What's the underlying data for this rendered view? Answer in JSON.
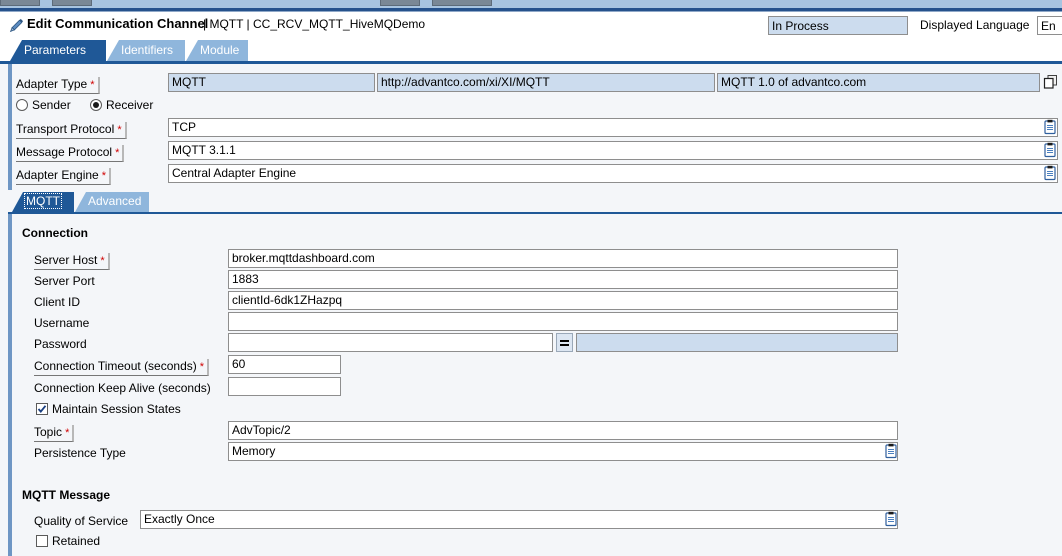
{
  "window": {
    "title": "Edit Communication Channel",
    "subtitle": "| MQTT | CC_RCV_MQTT_HiveMQDemo",
    "status": "In Process",
    "language_label": "Displayed Language",
    "language_value": "En"
  },
  "tabs_primary": [
    {
      "label": "Parameters",
      "active": true
    },
    {
      "label": "Identifiers",
      "active": false
    },
    {
      "label": "Module",
      "active": false
    }
  ],
  "adapter": {
    "type_label": "Adapter Type",
    "type_value": "MQTT",
    "namespace_value": "http://advantco.com/xi/XI/MQTT",
    "description_value": "MQTT 1.0 of advantco.com",
    "direction": {
      "sender_label": "Sender",
      "receiver_label": "Receiver",
      "selected": "Receiver"
    },
    "transport_protocol_label": "Transport Protocol",
    "transport_protocol_value": "TCP",
    "message_protocol_label": "Message Protocol",
    "message_protocol_value": "MQTT 3.1.1",
    "adapter_engine_label": "Adapter Engine",
    "adapter_engine_value": "Central Adapter Engine"
  },
  "tabs_secondary": [
    {
      "label": "MQTT",
      "active": true
    },
    {
      "label": "Advanced",
      "active": false
    }
  ],
  "connection": {
    "section_title": "Connection",
    "server_host_label": "Server Host",
    "server_host_value": "broker.mqttdashboard.com",
    "server_port_label": "Server Port",
    "server_port_value": "1883",
    "client_id_label": "Client ID",
    "client_id_value": "clientId-6dk1ZHazpq",
    "username_label": "Username",
    "username_value": "",
    "password_label": "Password",
    "password_value": "",
    "password_confirm_value": "",
    "connection_timeout_label": "Connection Timeout (seconds)",
    "connection_timeout_value": "60",
    "keep_alive_label": "Connection Keep Alive (seconds)",
    "keep_alive_value": "",
    "maintain_session_label": "Maintain Session States",
    "maintain_session_checked": true,
    "topic_label": "Topic",
    "topic_value": "AdvTopic/2",
    "persistence_type_label": "Persistence Type",
    "persistence_type_value": "Memory"
  },
  "mqtt_message": {
    "section_title": "MQTT Message",
    "qos_label": "Quality of Service",
    "qos_value": "Exactly Once",
    "retained_label": "Retained",
    "retained_checked": false
  },
  "colors": {
    "accent_blue": "#1f5897",
    "tab_inactive": "#8fb6dc",
    "readonly_field": "#ccdcee",
    "page_bg": "#f4f6f9",
    "required_star": "#d00000"
  }
}
